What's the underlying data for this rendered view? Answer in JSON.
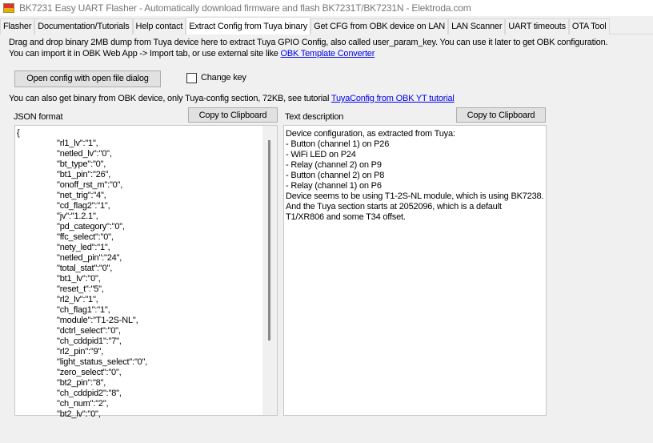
{
  "window": {
    "title": "BK7231 Easy UART Flasher - Automatically download firmware and flash BK7231T/BK7231N  - Elektroda.com"
  },
  "tabs": [
    {
      "label": "Flasher"
    },
    {
      "label": "Documentation/Tutorials"
    },
    {
      "label": "Help contact"
    },
    {
      "label": "Extract Config from Tuya binary",
      "active": true
    },
    {
      "label": "Get CFG from OBK device on LAN"
    },
    {
      "label": "LAN Scanner"
    },
    {
      "label": "UART timeouts"
    },
    {
      "label": "OTA Tool"
    }
  ],
  "intro": {
    "line1": "Drag and drop binary 2MB dump from Tuya device here to extract  Tuya GPIO Config, also called user_param_key. You can use it later to get OBK configuration.",
    "line2": "You can import it in OBK Web App -> Import tab, or use external site like ",
    "link": "OBK Template Converter"
  },
  "open_button": "Open config with open file dialog",
  "change_key": {
    "label": "Change key",
    "checked": false
  },
  "obk_note": {
    "text": "You can also get binary from OBK device, only Tuya-config section, 72KB, see tutorial ",
    "link": "TuyaConfig from OBK YT tutorial"
  },
  "json_panel": {
    "label": "JSON format",
    "copy": "Copy to Clipboard",
    "open": "{",
    "lines": [
      "\"rl1_lv\":\"1\",",
      "\"netled_lv\":\"0\",",
      "\"bt_type\":\"0\",",
      "\"bt1_pin\":\"26\",",
      "\"onoff_rst_m\":\"0\",",
      "\"net_trig\":\"4\",",
      "\"cd_flag2\":\"1\",",
      "\"jv\":\"1.2.1\",",
      "\"pd_category\":\"0\",",
      "\"ffc_select\":\"0\",",
      "\"nety_led\":\"1\",",
      "\"netled_pin\":\"24\",",
      "\"total_stat\":\"0\",",
      "\"bt1_lv\":\"0\",",
      "\"reset_t\":\"5\",",
      "\"rl2_lv\":\"1\",",
      "\"ch_flag1\":\"1\",",
      "\"module\":\"T1-2S-NL\",",
      "\"dctrl_select\":\"0\",",
      "\"ch_cddpid1\":\"7\",",
      "\"rl2_pin\":\"9\",",
      "\"light_status_select\":\"0\",",
      "\"zero_select\":\"0\",",
      "\"bt2_pin\":\"8\",",
      "\"ch_cddpid2\":\"8\",",
      "\"ch_num\":\"2\",",
      "\"bt2_lv\":\"0\","
    ]
  },
  "text_panel": {
    "label": "Text description",
    "copy": "Copy to Clipboard",
    "lines": [
      "Device configuration, as extracted from Tuya:",
      "- Button (channel 1) on P26",
      "- WiFi LED on P24",
      "- Relay (channel 2) on P9",
      "- Button (channel 2) on P8",
      "- Relay (channel 1) on P6",
      "Device seems to be using T1-2S-NL module, which is using BK7238.",
      "And the Tuya section starts at 2052096, which is a default",
      "T1/XR806 and some T34 offset."
    ]
  }
}
